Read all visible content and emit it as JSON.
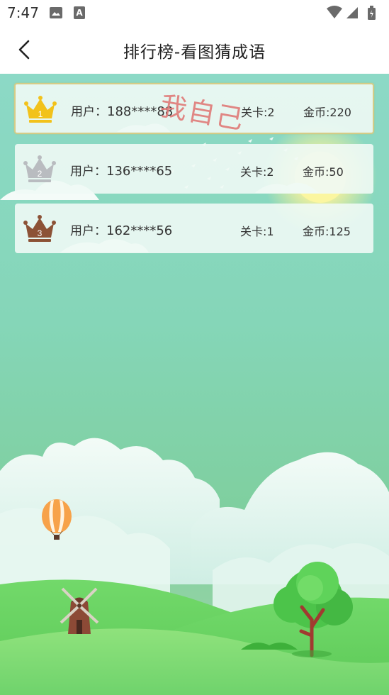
{
  "status_bar": {
    "time": "7:47",
    "icons": [
      "image-icon",
      "text-icon",
      "wifi-icon",
      "signal-icon",
      "battery-icon"
    ]
  },
  "header": {
    "back_icon": "chevron-left-icon",
    "title": "排行榜-看图猜成语"
  },
  "leaderboard": {
    "self_tag": "我自己",
    "rows": [
      {
        "rank": "1",
        "crown_color": "#f2c21b",
        "user_label": "用户：",
        "user": "188****88",
        "level": "关卡:2",
        "coins": "金币:220",
        "is_self": true
      },
      {
        "rank": "2",
        "crown_color": "#b9bcc0",
        "user_label": "用户：",
        "user": "136****65",
        "level": "关卡:2",
        "coins": "金币:50",
        "is_self": false
      },
      {
        "rank": "3",
        "crown_color": "#8c5236",
        "user_label": "用户：",
        "user": "162****56",
        "level": "关卡:1",
        "coins": "金币:125",
        "is_self": false
      }
    ]
  },
  "colors": {
    "sky_top": "#8cd9c6",
    "hill": "#6fd36c",
    "self_border": "#d5cc86",
    "self_tag": "#e07a78"
  }
}
